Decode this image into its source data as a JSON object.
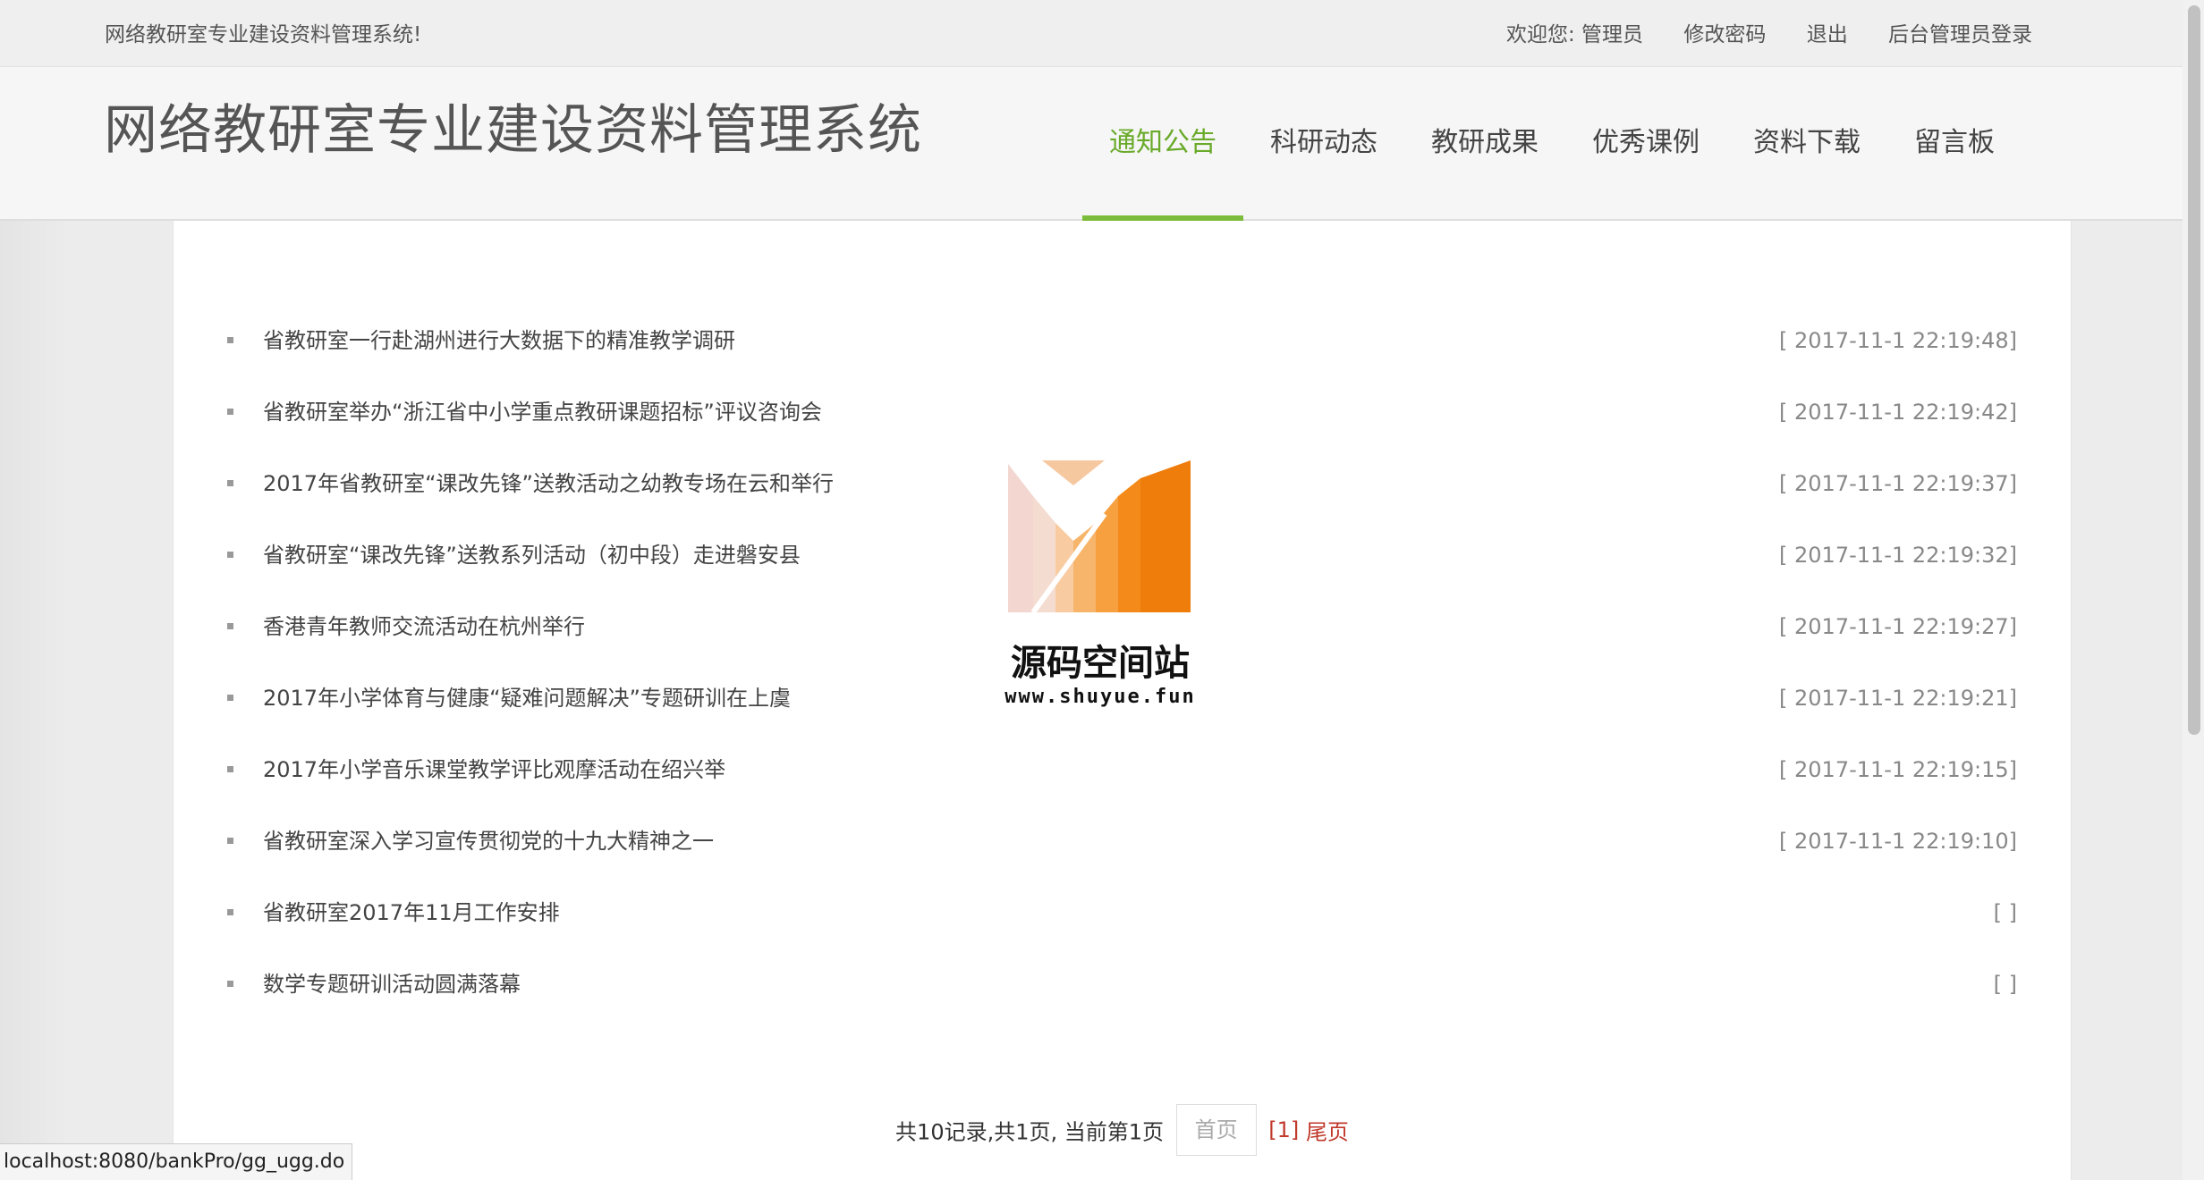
{
  "topbar": {
    "slogan": "网络教研室专业建设资料管理系统!",
    "welcome": "欢迎您: 管理员",
    "change_password": "修改密码",
    "logout": "退出",
    "admin_login": "后台管理员登录"
  },
  "header": {
    "title": "网络教研室专业建设资料管理系统",
    "nav": [
      {
        "label": "通知公告",
        "active": true
      },
      {
        "label": "科研动态"
      },
      {
        "label": "教研成果"
      },
      {
        "label": "优秀课例"
      },
      {
        "label": "资料下载"
      },
      {
        "label": "留言板"
      }
    ]
  },
  "news": [
    {
      "title": "省教研室一行赴湖州进行大数据下的精准教学调研",
      "date": "[ 2017-11-1 22:19:48]"
    },
    {
      "title": "省教研室举办“浙江省中小学重点教研课题招标”评议咨询会",
      "date": "[ 2017-11-1 22:19:42]"
    },
    {
      "title": "2017年省教研室“课改先锋”送教活动之幼教专场在云和举行",
      "date": "[ 2017-11-1 22:19:37]"
    },
    {
      "title": "省教研室“课改先锋”送教系列活动（初中段）走进磐安县",
      "date": "[ 2017-11-1 22:19:32]"
    },
    {
      "title": "香港青年教师交流活动在杭州举行",
      "date": "[ 2017-11-1 22:19:27]"
    },
    {
      "title": "2017年小学体育与健康“疑难问题解决”专题研训在上虞",
      "date": "[ 2017-11-1 22:19:21]"
    },
    {
      "title": "2017年小学音乐课堂教学评比观摩活动在绍兴举",
      "date": "[ 2017-11-1 22:19:15]"
    },
    {
      "title": "省教研室深入学习宣传贯彻党的十九大精神之一",
      "date": "[ 2017-11-1 22:19:10]"
    },
    {
      "title": "省教研室2017年11月工作安排",
      "date": "[ ]"
    },
    {
      "title": "数学专题研训活动圆满落幕",
      "date": "[ ]"
    }
  ],
  "pager": {
    "summary": "共10记录,共1页, 当前第1页",
    "first": "首页",
    "page": "[1]",
    "last": "尾页"
  },
  "watermark": {
    "title": "源码空间站",
    "url": "www.shuyue.fun"
  },
  "statusbar": {
    "url": "localhost:8080/bankPro/gg_ugg.do"
  }
}
